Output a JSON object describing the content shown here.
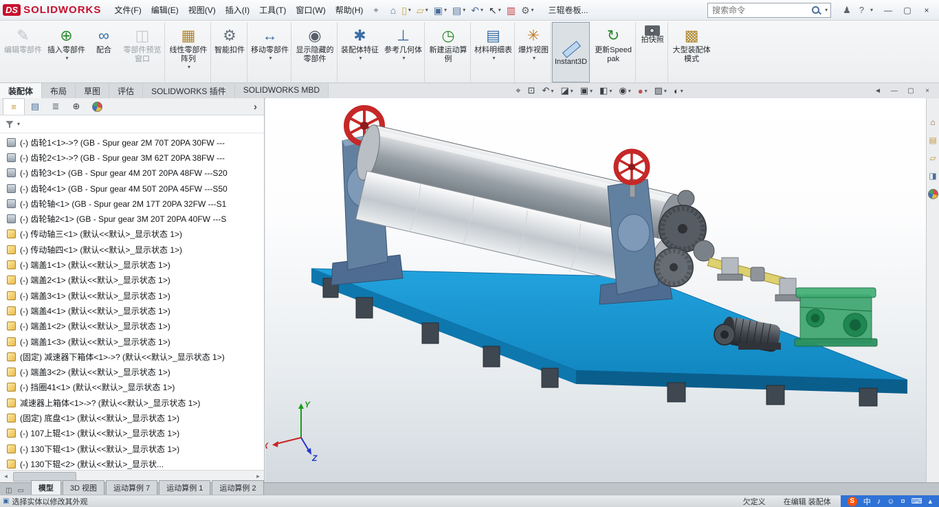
{
  "ui": {
    "arrow_down": "▾",
    "scroll_left": "◂",
    "scroll_right": "▸",
    "flyout": "›"
  },
  "titlebar": {
    "logo_ds": "DS",
    "logo_text": "SOLIDWORKS",
    "menus": [
      "文件(F)",
      "编辑(E)",
      "视图(V)",
      "插入(I)",
      "工具(T)",
      "窗口(W)",
      "帮助(H)"
    ],
    "pin_glyph": "⌖",
    "quick_icons": [
      {
        "name": "home-button",
        "glyph": "⌂",
        "color": "#4a6f9a"
      },
      {
        "name": "new-document-button",
        "glyph": "▯",
        "color": "#caa23a",
        "arrow": true
      },
      {
        "name": "open-document-button",
        "glyph": "▱",
        "color": "#caa23a",
        "arrow": true
      },
      {
        "name": "save-button",
        "glyph": "▣",
        "color": "#4a6f9a",
        "arrow": true
      },
      {
        "name": "print-button",
        "glyph": "▤",
        "color": "#4a6f9a",
        "arrow": true
      },
      {
        "name": "undo-button",
        "glyph": "↶",
        "color": "#4a6f9a",
        "arrow": true
      },
      {
        "name": "select-button",
        "glyph": "↖",
        "color": "#2b2f34",
        "arrow": true
      },
      {
        "name": "rebuild-button",
        "glyph": "▥",
        "color": "#c23b3b"
      },
      {
        "name": "options-button",
        "glyph": "⚙",
        "color": "#5c6268",
        "arrow": true
      }
    ],
    "doc_title": "三辊卷板...",
    "search_placeholder": "搜索命令",
    "login_glyph": "♟",
    "help_glyph": "?",
    "window_controls": [
      {
        "name": "minimize-button",
        "glyph": "—"
      },
      {
        "name": "restore-button",
        "glyph": "▢"
      },
      {
        "name": "close-button",
        "glyph": "×"
      }
    ]
  },
  "ribbon": {
    "buttons": [
      {
        "name": "edit-component-button",
        "label": "编辑零部件",
        "glyph": "✎",
        "color": "#8b9097",
        "disabled": true
      },
      {
        "name": "insert-components-button",
        "label": "插入零部件",
        "glyph": "⊕",
        "color": "#2e8b2e",
        "arrow": true
      },
      {
        "name": "mate-button",
        "label": "配合",
        "glyph": "∞",
        "color": "#3a6ea5"
      },
      {
        "name": "component-preview-window-button",
        "label": "零部件预览窗口",
        "glyph": "◫",
        "color": "#9aa0a6",
        "disabled": true,
        "sep": true
      },
      {
        "name": "linear-component-pattern-button",
        "label": "线性零部件阵列",
        "glyph": "▦",
        "color": "#b08830",
        "arrow": true,
        "sep": true
      },
      {
        "name": "smart-fasteners-button",
        "label": "智能扣件",
        "glyph": "⚙",
        "color": "#6b7480",
        "sep": true
      },
      {
        "name": "move-component-button",
        "label": "移动零部件",
        "glyph": "↔",
        "color": "#3a6ea5",
        "arrow": true,
        "sep": true
      },
      {
        "name": "show-hidden-components-button",
        "label": "显示隐藏的零部件",
        "glyph": "◉",
        "color": "#55606a",
        "sep": true
      },
      {
        "name": "assembly-features-button",
        "label": "装配体特征",
        "glyph": "✱",
        "color": "#3a6ea5",
        "arrow": true
      },
      {
        "name": "reference-geometry-button",
        "label": "参考几何体",
        "glyph": "⊥",
        "color": "#3a6ea5",
        "arrow": true,
        "sep": true
      },
      {
        "name": "new-motion-study-button",
        "label": "新建运动算例",
        "glyph": "◷",
        "color": "#2e8b2e",
        "sep": true
      },
      {
        "name": "bill-of-materials-button",
        "label": "材料明细表",
        "glyph": "▤",
        "color": "#3a6ea5",
        "arrow": true,
        "sep": true
      },
      {
        "name": "exploded-view-button",
        "label": "爆炸视图",
        "glyph": "✳",
        "color": "#c07a2a",
        "arrow": true,
        "sep": true
      },
      {
        "name": "instant3d-button",
        "label": "Instant3D",
        "icon": "ruler",
        "active": true,
        "sep": true
      },
      {
        "name": "update-speedpak-button",
        "label": "更新Speedpak",
        "glyph": "↻",
        "color": "#2e8b2e",
        "sep": true
      },
      {
        "name": "take-snapshot-button",
        "label": "拍快照",
        "icon": "camera",
        "sep": true
      },
      {
        "name": "large-assembly-mode-button",
        "label": "大型装配体模式",
        "glyph": "▩",
        "color": "#b08830"
      }
    ]
  },
  "commandtabs": {
    "items": [
      {
        "label": "装配体",
        "active": true
      },
      {
        "label": "布局"
      },
      {
        "label": "草图"
      },
      {
        "label": "评估"
      },
      {
        "label": "SOLIDWORKS 插件"
      },
      {
        "label": "SOLIDWORKS MBD"
      }
    ]
  },
  "viewbar": {
    "icons": [
      {
        "name": "zoom-fit-button",
        "glyph": "⌖"
      },
      {
        "name": "zoom-area-button",
        "glyph": "⊡"
      },
      {
        "name": "previous-view-button",
        "glyph": "↶",
        "arrow": true
      },
      {
        "name": "section-view-button",
        "glyph": "◪",
        "arrow": true
      },
      {
        "name": "view-orientation-button",
        "glyph": "▣",
        "arrow": true
      },
      {
        "name": "display-style-button",
        "glyph": "◧",
        "arrow": true
      },
      {
        "name": "hide-show-items-button",
        "glyph": "◉",
        "arrow": true
      },
      {
        "name": "edit-appearance-button",
        "glyph": "●",
        "color": "#c05050",
        "arrow": true
      },
      {
        "name": "apply-scene-button",
        "glyph": "▨",
        "arrow": true
      },
      {
        "name": "view-settings-button",
        "glyph": "◐",
        "arrow": true
      }
    ]
  },
  "docwindow": {
    "controls": [
      {
        "name": "previous-window-button",
        "glyph": "◄"
      },
      {
        "name": "doc-minimize-button",
        "glyph": "—"
      },
      {
        "name": "doc-restore-button",
        "glyph": "▢"
      },
      {
        "name": "doc-close-button",
        "glyph": "×"
      }
    ]
  },
  "panel": {
    "tabs": [
      {
        "name": "featuremanager-tab",
        "glyph": "≡",
        "color": "#c29a3a",
        "active": true
      },
      {
        "name": "propertymanager-tab",
        "glyph": "▤",
        "color": "#4a6f9a"
      },
      {
        "name": "configurationmanager-tab",
        "glyph": "≣",
        "color": "#6a6f75"
      },
      {
        "name": "dimxpertmanager-tab",
        "glyph": "⊕",
        "color": "#3b3f44"
      },
      {
        "name": "displaymanager-tab",
        "icon": "ball"
      }
    ]
  },
  "tree": {
    "items": [
      {
        "icon": "toolbox",
        "label": "(-) 齿轮1<1>->? (GB - Spur gear 2M 70T 20PA 30FW ---"
      },
      {
        "icon": "toolbox",
        "label": "(-) 齿轮2<1>->? (GB - Spur gear 3M 62T 20PA 38FW ---"
      },
      {
        "icon": "toolbox",
        "label": "(-) 齿轮3<1> (GB - Spur gear 4M 20T 20PA 48FW ---S20"
      },
      {
        "icon": "toolbox",
        "label": "(-) 齿轮4<1> (GB - Spur gear 4M 50T 20PA 45FW ---S50"
      },
      {
        "icon": "toolbox",
        "label": "(-) 齿轮轴<1> (GB - Spur gear 2M 17T 20PA 32FW ---S1"
      },
      {
        "icon": "toolbox",
        "label": "(-) 齿轮轴2<1> (GB - Spur gear 3M 20T 20PA 40FW ---S"
      },
      {
        "icon": "part",
        "label": "(-) 传动轴三<1> (默认<<默认>_显示状态 1>)"
      },
      {
        "icon": "part",
        "label": "(-) 传动轴四<1> (默认<<默认>_显示状态 1>)"
      },
      {
        "icon": "part",
        "label": "(-) 端盖1<1> (默认<<默认>_显示状态 1>)"
      },
      {
        "icon": "part",
        "label": "(-) 端盖2<1> (默认<<默认>_显示状态 1>)"
      },
      {
        "icon": "part",
        "label": "(-) 端盖3<1> (默认<<默认>_显示状态 1>)"
      },
      {
        "icon": "part",
        "label": "(-) 端盖4<1> (默认<<默认>_显示状态 1>)"
      },
      {
        "icon": "part",
        "label": "(-) 端盖1<2> (默认<<默认>_显示状态 1>)"
      },
      {
        "icon": "part",
        "label": "(-) 端盖1<3> (默认<<默认>_显示状态 1>)"
      },
      {
        "icon": "part",
        "label": "(固定) 减速器下箱体<1>->? (默认<<默认>_显示状态 1>)"
      },
      {
        "icon": "part",
        "label": "(-) 端盖3<2> (默认<<默认>_显示状态 1>)"
      },
      {
        "icon": "part",
        "label": "(-) 挡圈41<1> (默认<<默认>_显示状态 1>)"
      },
      {
        "icon": "part",
        "label": "减速器上箱体<1>->? (默认<<默认>_显示状态 1>)"
      },
      {
        "icon": "part",
        "label": "(固定) 底盘<1> (默认<<默认>_显示状态 1>)"
      },
      {
        "icon": "part",
        "label": "(-) 107上辊<1> (默认<<默认>_显示状态 1>)"
      },
      {
        "icon": "part",
        "label": "(-) 130下辊<1> (默认<<默认>_显示状态 1>)"
      },
      {
        "icon": "part",
        "label": "(-) 130下辊<2> (默认<<默认>_显示状..."
      }
    ]
  },
  "viewport": {
    "triad_x": "X",
    "triad_y": "Y",
    "triad_z": "Z"
  },
  "taskpane": {
    "icons": [
      {
        "name": "solidworks-resources-tab",
        "glyph": "⌂",
        "color": "#9a5b2a"
      },
      {
        "name": "design-library-tab",
        "glyph": "▤",
        "color": "#c29a3a"
      },
      {
        "name": "file-explorer-tab",
        "glyph": "▱",
        "color": "#c29a3a"
      },
      {
        "name": "view-palette-tab",
        "glyph": "◨",
        "color": "#4a6f9a"
      },
      {
        "name": "appearances-scenes-tab",
        "icon": "ball"
      }
    ]
  },
  "motionbar": {
    "tools": [
      {
        "name": "split-horizontal-icon",
        "glyph": "◫"
      },
      {
        "name": "split-vertical-icon",
        "glyph": "▭"
      }
    ],
    "tabs": [
      {
        "label": "模型",
        "active": true
      },
      {
        "label": "3D 视图"
      },
      {
        "label": "运动算例 7"
      },
      {
        "label": "运动算例 1"
      },
      {
        "label": "运动算例 2"
      }
    ]
  },
  "statusbar": {
    "icon_glyph": "▣",
    "left": "选择实体以修改其外观",
    "state": "欠定义",
    "editing": "在编辑 装配体",
    "sogou": "S",
    "tray": [
      {
        "name": "ime-chinese-indicator",
        "glyph": "中"
      },
      {
        "name": "speaker-icon",
        "glyph": "♪"
      },
      {
        "name": "smiley-icon",
        "glyph": "☺"
      },
      {
        "name": "mic-icon",
        "glyph": "¤"
      },
      {
        "name": "keyboard-icon",
        "glyph": "⌨"
      },
      {
        "name": "tray-expand-icon",
        "glyph": "▴"
      }
    ]
  }
}
